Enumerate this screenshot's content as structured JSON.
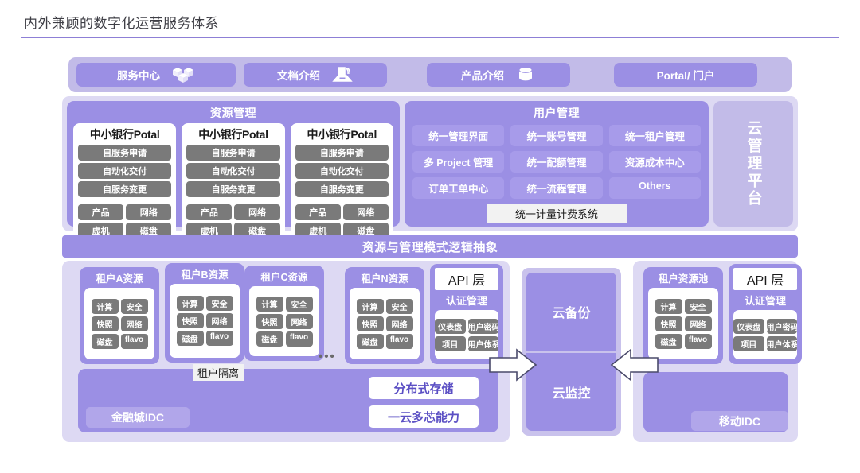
{
  "header": {
    "title": "内外兼顾的数字化运营服务体系"
  },
  "colors": {
    "accent": "#8d7fd6",
    "panel_purple": "#9b8fe4",
    "panel_light": "#ddd9f3",
    "bar_light": "#c2bbe8",
    "chip_gray": "#7a7a7a",
    "pill_purple": "#a79bea",
    "text_dark": "#1b1b1b"
  },
  "top_bar": {
    "services": [
      {
        "label": "服务中心",
        "icon": "cubes-icon"
      },
      {
        "label": "文档介绍",
        "icon": "document-box-icon"
      },
      {
        "label": "产品介绍",
        "icon": "database-icon"
      },
      {
        "label": "Portal/ 门户",
        "icon": "none"
      }
    ]
  },
  "resource_management": {
    "title": "资源管理",
    "portals": [
      {
        "name": "中小银行Potal",
        "actions": [
          "自服务申请",
          "自动化交付",
          "自服务变更"
        ],
        "tags": [
          "产品",
          "网络",
          "虚机",
          "磁盘"
        ]
      },
      {
        "name": "中小银行Potal",
        "actions": [
          "自服务申请",
          "自动化交付",
          "自服务变更"
        ],
        "tags": [
          "产品",
          "网络",
          "虚机",
          "磁盘"
        ]
      },
      {
        "name": "中小银行Potal",
        "actions": [
          "自服务申请",
          "自动化交付",
          "自服务变更"
        ],
        "tags": [
          "产品",
          "网络",
          "虚机",
          "磁盘"
        ]
      }
    ]
  },
  "user_management": {
    "title": "用户管理",
    "items": [
      "统一管理界面",
      "统一账号管理",
      "统一租户管理",
      "多 Project 管理",
      "统一配额管理",
      "资源成本中心",
      "订单工单中心",
      "统一流程管理",
      "Others"
    ],
    "metering": "统一计量计费系统"
  },
  "cloud_platform": {
    "label": "云管理平台"
  },
  "abstraction_band": {
    "label": "资源与管理模式逻辑抽象"
  },
  "tenants": [
    {
      "title": "租户A资源",
      "chips": [
        "计算",
        "安全",
        "快照",
        "网络",
        "磁盘",
        "flavo"
      ]
    },
    {
      "title": "租户B资源",
      "chips": [
        "计算",
        "安全",
        "快照",
        "网络",
        "磁盘",
        "flavo"
      ]
    },
    {
      "title": "租户C资源",
      "chips": [
        "计算",
        "安全",
        "快照",
        "网络",
        "磁盘",
        "flavo"
      ]
    },
    {
      "title": "租户N资源",
      "chips": [
        "计算",
        "安全",
        "快照",
        "网络",
        "磁盘",
        "flavo"
      ]
    }
  ],
  "tenant_pool": {
    "title": "租户资源池",
    "chips": [
      "计算",
      "安全",
      "快照",
      "网络",
      "磁盘",
      "flavo"
    ]
  },
  "ellipsis": "•••",
  "api_left": {
    "label": "API 层",
    "sub": "认证管理",
    "chips": [
      "仪表盘",
      "用户密码",
      "项目",
      "用户体系"
    ]
  },
  "api_right": {
    "label": "API 层",
    "sub": "认证管理",
    "chips": [
      "仪表盘",
      "用户密码",
      "项目",
      "用户体系"
    ]
  },
  "center": {
    "backup": "云备份",
    "monitor": "云监控"
  },
  "isolation": {
    "label": "租户隔离"
  },
  "idc": {
    "left": "金融城IDC",
    "right": "移动IDC"
  },
  "capabilities": [
    "分布式存储",
    "一云多芯能力"
  ]
}
